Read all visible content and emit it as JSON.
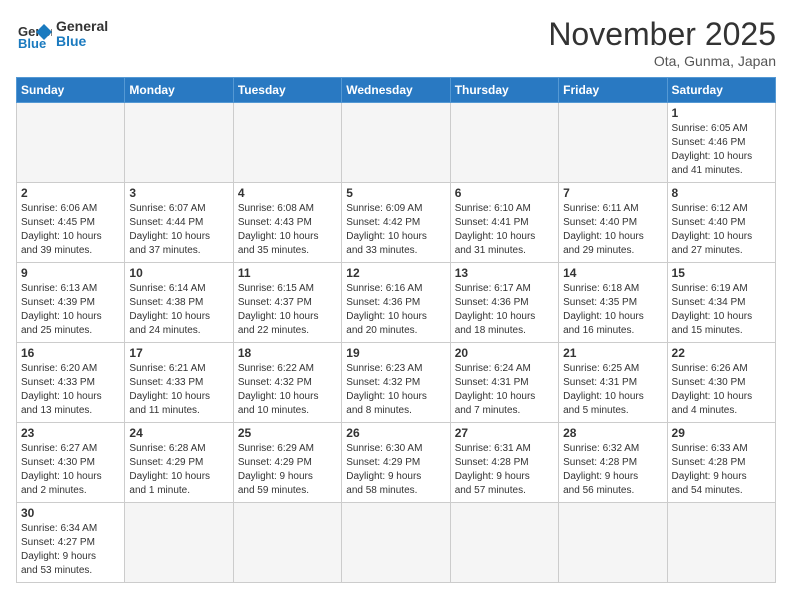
{
  "logo": {
    "text_general": "General",
    "text_blue": "Blue"
  },
  "title": "November 2025",
  "subtitle": "Ota, Gunma, Japan",
  "weekdays": [
    "Sunday",
    "Monday",
    "Tuesday",
    "Wednesday",
    "Thursday",
    "Friday",
    "Saturday"
  ],
  "weeks": [
    [
      {
        "day": "",
        "info": "",
        "empty": true
      },
      {
        "day": "",
        "info": "",
        "empty": true
      },
      {
        "day": "",
        "info": "",
        "empty": true
      },
      {
        "day": "",
        "info": "",
        "empty": true
      },
      {
        "day": "",
        "info": "",
        "empty": true
      },
      {
        "day": "",
        "info": "",
        "empty": true
      },
      {
        "day": "1",
        "info": "Sunrise: 6:05 AM\nSunset: 4:46 PM\nDaylight: 10 hours\nand 41 minutes.",
        "empty": false
      }
    ],
    [
      {
        "day": "2",
        "info": "Sunrise: 6:06 AM\nSunset: 4:45 PM\nDaylight: 10 hours\nand 39 minutes.",
        "empty": false
      },
      {
        "day": "3",
        "info": "Sunrise: 6:07 AM\nSunset: 4:44 PM\nDaylight: 10 hours\nand 37 minutes.",
        "empty": false
      },
      {
        "day": "4",
        "info": "Sunrise: 6:08 AM\nSunset: 4:43 PM\nDaylight: 10 hours\nand 35 minutes.",
        "empty": false
      },
      {
        "day": "5",
        "info": "Sunrise: 6:09 AM\nSunset: 4:42 PM\nDaylight: 10 hours\nand 33 minutes.",
        "empty": false
      },
      {
        "day": "6",
        "info": "Sunrise: 6:10 AM\nSunset: 4:41 PM\nDaylight: 10 hours\nand 31 minutes.",
        "empty": false
      },
      {
        "day": "7",
        "info": "Sunrise: 6:11 AM\nSunset: 4:40 PM\nDaylight: 10 hours\nand 29 minutes.",
        "empty": false
      },
      {
        "day": "8",
        "info": "Sunrise: 6:12 AM\nSunset: 4:40 PM\nDaylight: 10 hours\nand 27 minutes.",
        "empty": false
      }
    ],
    [
      {
        "day": "9",
        "info": "Sunrise: 6:13 AM\nSunset: 4:39 PM\nDaylight: 10 hours\nand 25 minutes.",
        "empty": false
      },
      {
        "day": "10",
        "info": "Sunrise: 6:14 AM\nSunset: 4:38 PM\nDaylight: 10 hours\nand 24 minutes.",
        "empty": false
      },
      {
        "day": "11",
        "info": "Sunrise: 6:15 AM\nSunset: 4:37 PM\nDaylight: 10 hours\nand 22 minutes.",
        "empty": false
      },
      {
        "day": "12",
        "info": "Sunrise: 6:16 AM\nSunset: 4:36 PM\nDaylight: 10 hours\nand 20 minutes.",
        "empty": false
      },
      {
        "day": "13",
        "info": "Sunrise: 6:17 AM\nSunset: 4:36 PM\nDaylight: 10 hours\nand 18 minutes.",
        "empty": false
      },
      {
        "day": "14",
        "info": "Sunrise: 6:18 AM\nSunset: 4:35 PM\nDaylight: 10 hours\nand 16 minutes.",
        "empty": false
      },
      {
        "day": "15",
        "info": "Sunrise: 6:19 AM\nSunset: 4:34 PM\nDaylight: 10 hours\nand 15 minutes.",
        "empty": false
      }
    ],
    [
      {
        "day": "16",
        "info": "Sunrise: 6:20 AM\nSunset: 4:33 PM\nDaylight: 10 hours\nand 13 minutes.",
        "empty": false
      },
      {
        "day": "17",
        "info": "Sunrise: 6:21 AM\nSunset: 4:33 PM\nDaylight: 10 hours\nand 11 minutes.",
        "empty": false
      },
      {
        "day": "18",
        "info": "Sunrise: 6:22 AM\nSunset: 4:32 PM\nDaylight: 10 hours\nand 10 minutes.",
        "empty": false
      },
      {
        "day": "19",
        "info": "Sunrise: 6:23 AM\nSunset: 4:32 PM\nDaylight: 10 hours\nand 8 minutes.",
        "empty": false
      },
      {
        "day": "20",
        "info": "Sunrise: 6:24 AM\nSunset: 4:31 PM\nDaylight: 10 hours\nand 7 minutes.",
        "empty": false
      },
      {
        "day": "21",
        "info": "Sunrise: 6:25 AM\nSunset: 4:31 PM\nDaylight: 10 hours\nand 5 minutes.",
        "empty": false
      },
      {
        "day": "22",
        "info": "Sunrise: 6:26 AM\nSunset: 4:30 PM\nDaylight: 10 hours\nand 4 minutes.",
        "empty": false
      }
    ],
    [
      {
        "day": "23",
        "info": "Sunrise: 6:27 AM\nSunset: 4:30 PM\nDaylight: 10 hours\nand 2 minutes.",
        "empty": false
      },
      {
        "day": "24",
        "info": "Sunrise: 6:28 AM\nSunset: 4:29 PM\nDaylight: 10 hours\nand 1 minute.",
        "empty": false
      },
      {
        "day": "25",
        "info": "Sunrise: 6:29 AM\nSunset: 4:29 PM\nDaylight: 9 hours\nand 59 minutes.",
        "empty": false
      },
      {
        "day": "26",
        "info": "Sunrise: 6:30 AM\nSunset: 4:29 PM\nDaylight: 9 hours\nand 58 minutes.",
        "empty": false
      },
      {
        "day": "27",
        "info": "Sunrise: 6:31 AM\nSunset: 4:28 PM\nDaylight: 9 hours\nand 57 minutes.",
        "empty": false
      },
      {
        "day": "28",
        "info": "Sunrise: 6:32 AM\nSunset: 4:28 PM\nDaylight: 9 hours\nand 56 minutes.",
        "empty": false
      },
      {
        "day": "29",
        "info": "Sunrise: 6:33 AM\nSunset: 4:28 PM\nDaylight: 9 hours\nand 54 minutes.",
        "empty": false
      }
    ],
    [
      {
        "day": "30",
        "info": "Sunrise: 6:34 AM\nSunset: 4:27 PM\nDaylight: 9 hours\nand 53 minutes.",
        "empty": false
      },
      {
        "day": "",
        "info": "",
        "empty": true
      },
      {
        "day": "",
        "info": "",
        "empty": true
      },
      {
        "day": "",
        "info": "",
        "empty": true
      },
      {
        "day": "",
        "info": "",
        "empty": true
      },
      {
        "day": "",
        "info": "",
        "empty": true
      },
      {
        "day": "",
        "info": "",
        "empty": true
      }
    ]
  ]
}
